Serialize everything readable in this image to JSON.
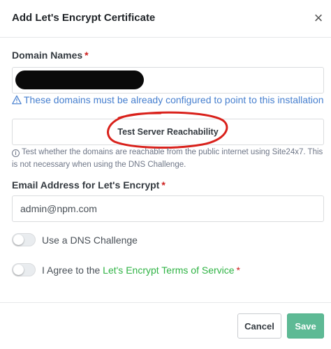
{
  "modal": {
    "title": "Add Let's Encrypt Certificate",
    "close_icon": "close-icon"
  },
  "domain_names": {
    "label": "Domain Names",
    "required_mark": "*",
    "value_redacted": true,
    "info_text": "These domains must be already configured to point to this installation",
    "info_icon": "warning-triangle-icon"
  },
  "reachability": {
    "button_label": "Test Server Reachability",
    "annotation_color": "#d9211b",
    "hint_icon": "info-circle-icon",
    "hint_text": "Test whether the domains are reachable from the public internet using Site24x7. This is not necessary when using the DNS Challenge."
  },
  "email": {
    "label": "Email Address for Let's Encrypt",
    "required_mark": "*",
    "value": "admin@npm.com"
  },
  "dns_challenge": {
    "label": "Use a DNS Challenge",
    "checked": false
  },
  "terms": {
    "prefix": "I Agree to the ",
    "link_text": "Let's Encrypt Terms of Service",
    "required_mark": "*",
    "checked": false
  },
  "footer": {
    "cancel_label": "Cancel",
    "save_label": "Save"
  },
  "colors": {
    "link": "#467fcf",
    "tos_link": "#2fb344",
    "save_button": "#5eba95",
    "required": "#cd201f"
  }
}
